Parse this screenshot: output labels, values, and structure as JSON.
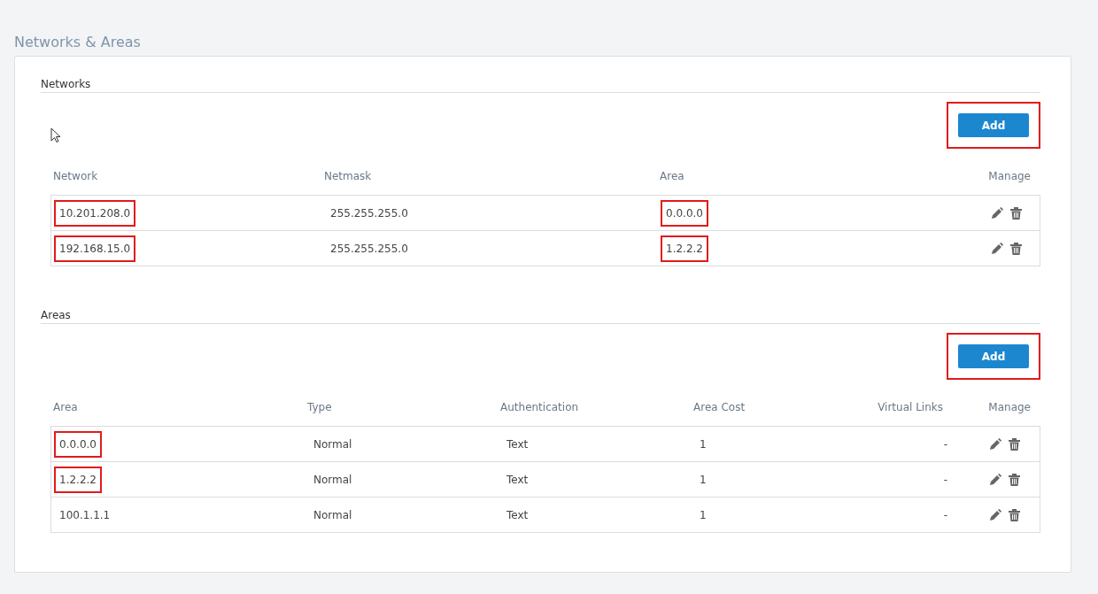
{
  "page_title": "Networks & Areas",
  "networks": {
    "title": "Networks",
    "add_button": {
      "label": "Add",
      "highlighted": true
    },
    "columns": [
      "Network",
      "Netmask",
      "Area",
      "Manage"
    ],
    "rows": [
      {
        "cells": [
          {
            "text": "10.201.208.0",
            "highlighted": true
          },
          {
            "text": "255.255.255.0",
            "highlighted": false
          },
          {
            "text": "0.0.0.0",
            "highlighted": true
          }
        ]
      },
      {
        "cells": [
          {
            "text": "192.168.15.0",
            "highlighted": true
          },
          {
            "text": "255.255.255.0",
            "highlighted": false
          },
          {
            "text": "1.2.2.2",
            "highlighted": true
          }
        ]
      }
    ]
  },
  "areas": {
    "title": "Areas",
    "add_button": {
      "label": "Add",
      "highlighted": true
    },
    "columns": [
      "Area",
      "Type",
      "Authentication",
      "Area Cost",
      "Virtual Links",
      "Manage"
    ],
    "rows": [
      {
        "cells": [
          {
            "text": "0.0.0.0",
            "highlighted": true
          },
          {
            "text": "Normal",
            "highlighted": false
          },
          {
            "text": "Text",
            "highlighted": false
          },
          {
            "text": "1",
            "highlighted": false
          },
          {
            "text": "-",
            "highlighted": false
          }
        ]
      },
      {
        "cells": [
          {
            "text": "1.2.2.2",
            "highlighted": true
          },
          {
            "text": "Normal",
            "highlighted": false
          },
          {
            "text": "Text",
            "highlighted": false
          },
          {
            "text": "1",
            "highlighted": false
          },
          {
            "text": "-",
            "highlighted": false
          }
        ]
      },
      {
        "cells": [
          {
            "text": "100.1.1.1",
            "highlighted": false
          },
          {
            "text": "Normal",
            "highlighted": false
          },
          {
            "text": "Text",
            "highlighted": false
          },
          {
            "text": "1",
            "highlighted": false
          },
          {
            "text": "-",
            "highlighted": false
          }
        ]
      }
    ]
  }
}
